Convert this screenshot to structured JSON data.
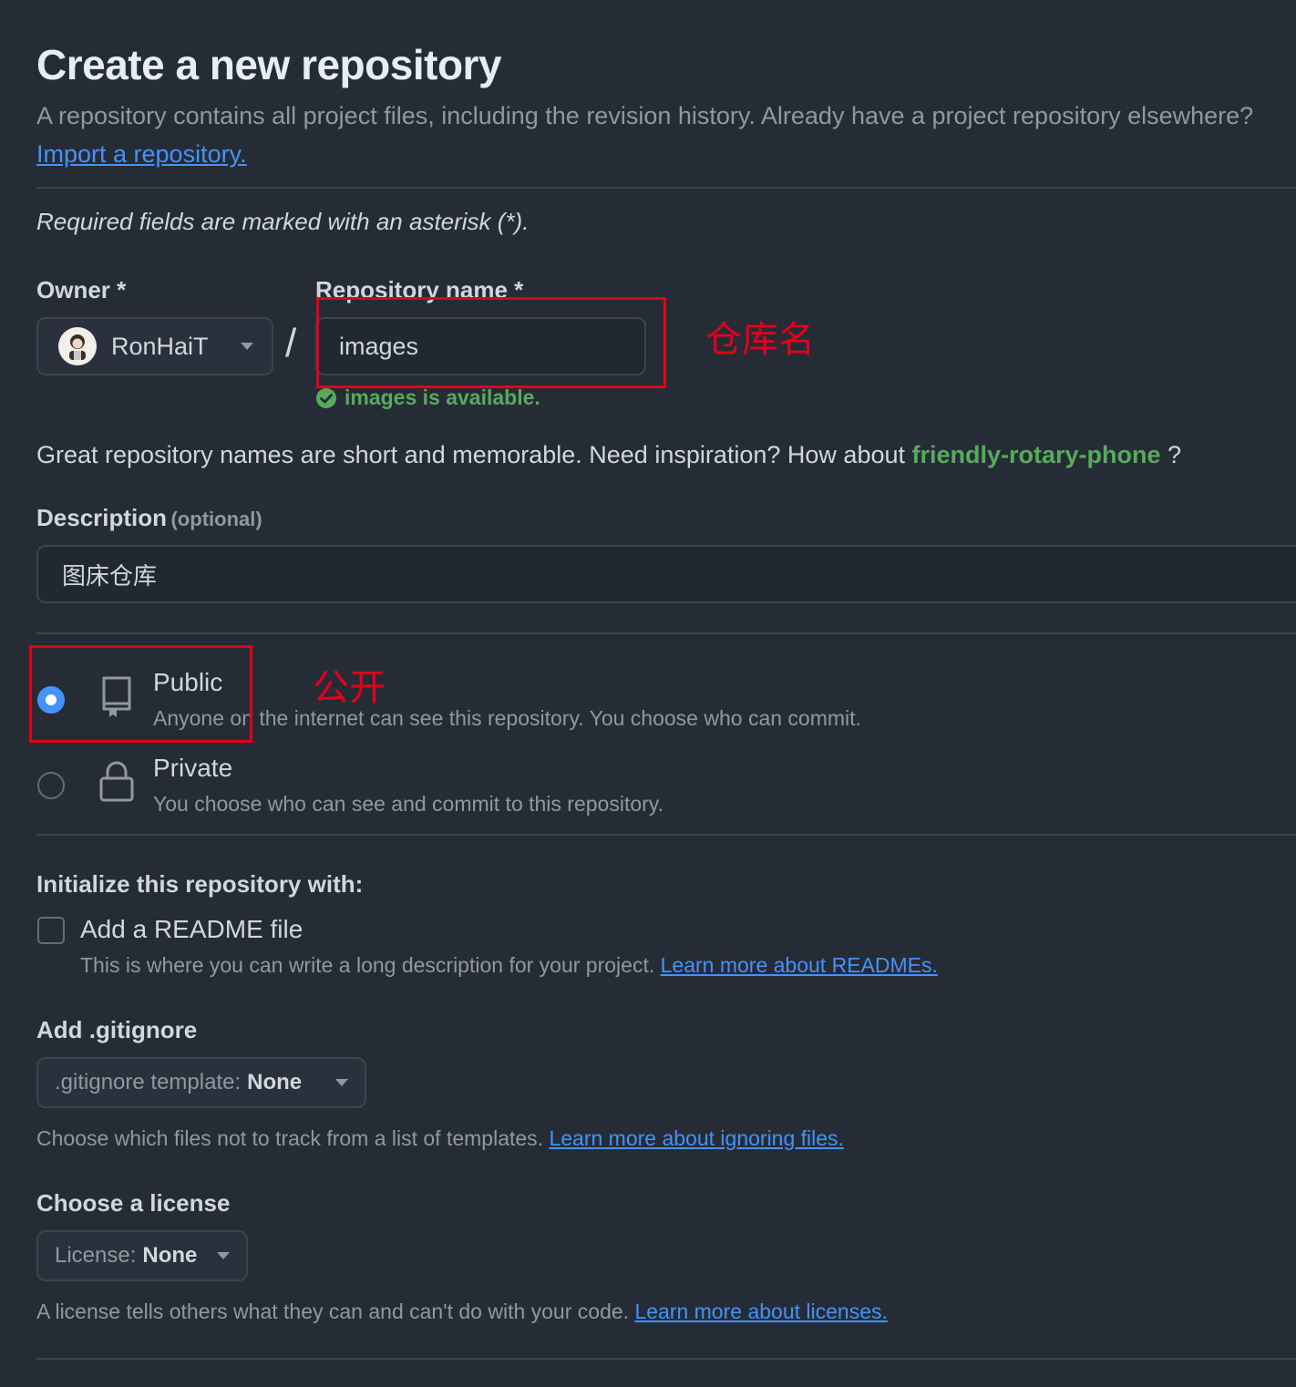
{
  "header": {
    "title": "Create a new repository",
    "lead_text": "A repository contains all project files, including the revision history. Already have a project repository elsewhere?",
    "import_link": "Import a repository."
  },
  "required_note": "Required fields are marked with an asterisk (*).",
  "owner": {
    "label": "Owner *",
    "value": "RonHaiT"
  },
  "separator": "/",
  "repo_name": {
    "label": "Repository name *",
    "value": "images",
    "availability": "images is available."
  },
  "suggestion": {
    "text": "Great repository names are short and memorable. Need inspiration? How about",
    "name": "friendly-rotary-phone",
    "suffix": "?"
  },
  "description": {
    "label": "Description",
    "optional": "(optional)",
    "value": "图床仓库"
  },
  "visibility": {
    "public": {
      "title": "Public",
      "desc": "Anyone on the internet can see this repository. You choose who can commit.",
      "checked": true
    },
    "private": {
      "title": "Private",
      "desc": "You choose who can see and commit to this repository.",
      "checked": false
    }
  },
  "init": {
    "heading": "Initialize this repository with:",
    "readme_label": "Add a README file",
    "readme_desc": "This is where you can write a long description for your project.",
    "readme_link": "Learn more about READMEs."
  },
  "gitignore": {
    "heading": "Add .gitignore",
    "button_prefix": ".gitignore template:",
    "button_value": "None",
    "desc": "Choose which files not to track from a list of templates.",
    "link": "Learn more about ignoring files."
  },
  "license": {
    "heading": "Choose a license",
    "button_prefix": "License:",
    "button_value": "None",
    "desc": "A license tells others what they can and can't do with your code.",
    "link": "Learn more about licenses."
  },
  "annotations": {
    "repo_name_note": "仓库名",
    "public_note": "公开",
    "color": "#e5001a"
  },
  "colors": {
    "background": "#262c36",
    "link": "#4493f8",
    "success": "#57ab5a",
    "annotation": "#e5001a"
  }
}
